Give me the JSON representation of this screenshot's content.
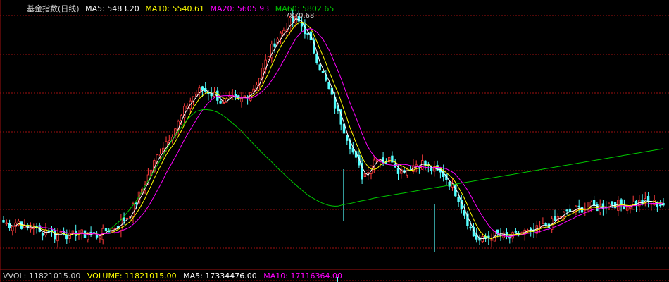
{
  "colors": {
    "up": "#ff3b3b",
    "down": "#54ffff",
    "ma5": "#ffffff",
    "ma10": "#ffff00",
    "ma20": "#ff00ff",
    "ma60": "#00c800",
    "grid": "#a01010",
    "label": "#cfcfcf"
  },
  "legend": {
    "name": "基金指数(日线)",
    "ma5": "MA5: 5483.20",
    "ma10": "MA10: 5540.61",
    "ma20": "MA20: 5605.93",
    "ma60": "MA60: 5802.65"
  },
  "peak_label": "7870.68",
  "volume_legend": {
    "vvol": "VVOL: 11821015.00",
    "volume": "VOLUME: 11821015.00",
    "ma5": "MA5: 17334476.00",
    "ma10": "MA10: 17116364.00"
  },
  "chart_data": {
    "type": "candlestick",
    "title": "基金指数(日线)",
    "ylim": [
      3900,
      7950
    ],
    "grid": true,
    "peak_value": 7870.68,
    "close_path": [
      4600,
      4550,
      4620,
      4480,
      4550,
      4420,
      4500,
      4380,
      4470,
      4360,
      4450,
      4400,
      4430,
      4380,
      4470,
      4500,
      4600,
      4700,
      4900,
      5150,
      5400,
      5650,
      5850,
      6000,
      6200,
      6450,
      6600,
      6700,
      6650,
      6600,
      6450,
      6550,
      6500,
      6600,
      6700,
      6900,
      7200,
      7450,
      7600,
      7750,
      7800,
      7650,
      7400,
      7100,
      6800,
      6500,
      6200,
      5900,
      5600,
      5300,
      5500,
      5650,
      5550,
      5600,
      5400,
      5450,
      5500,
      5550,
      5450,
      5400,
      5350,
      5200,
      5000,
      4700,
      4400,
      4300,
      4350,
      4400,
      4380,
      4350,
      4400,
      4450,
      4420,
      4500,
      4550,
      4600,
      4700,
      4750,
      4800,
      4820,
      4850,
      4830,
      4860,
      4900,
      4880,
      4870,
      4900,
      4920,
      4910,
      4900,
      4880
    ],
    "ma60_path": [
      null,
      null,
      null,
      null,
      null,
      null,
      null,
      null,
      null,
      null,
      null,
      null,
      null,
      null,
      4450,
      4550,
      4650,
      4800,
      4950,
      5150,
      5350,
      5550,
      5750,
      5950,
      6100,
      6250,
      6350,
      6380,
      6370,
      6330,
      6250,
      6150,
      6050,
      5920,
      5800,
      5680,
      5570,
      5450,
      5340,
      5230,
      5130,
      5030,
      4960,
      4900,
      4860,
      4850,
      4880,
      4900,
      4930,
      4950,
      4980,
      5000,
      5020,
      5040,
      5060,
      5080,
      5100,
      5120,
      5140,
      5160,
      5180,
      5200,
      5220,
      5240,
      5260,
      5280,
      5300,
      5320,
      5340,
      5360,
      5380,
      5400,
      5420,
      5440,
      5460,
      5480,
      5500,
      5520,
      5540,
      5560,
      5580,
      5600,
      5620,
      5640,
      5660,
      5680,
      5700,
      5720,
      5740,
      5760
    ]
  }
}
